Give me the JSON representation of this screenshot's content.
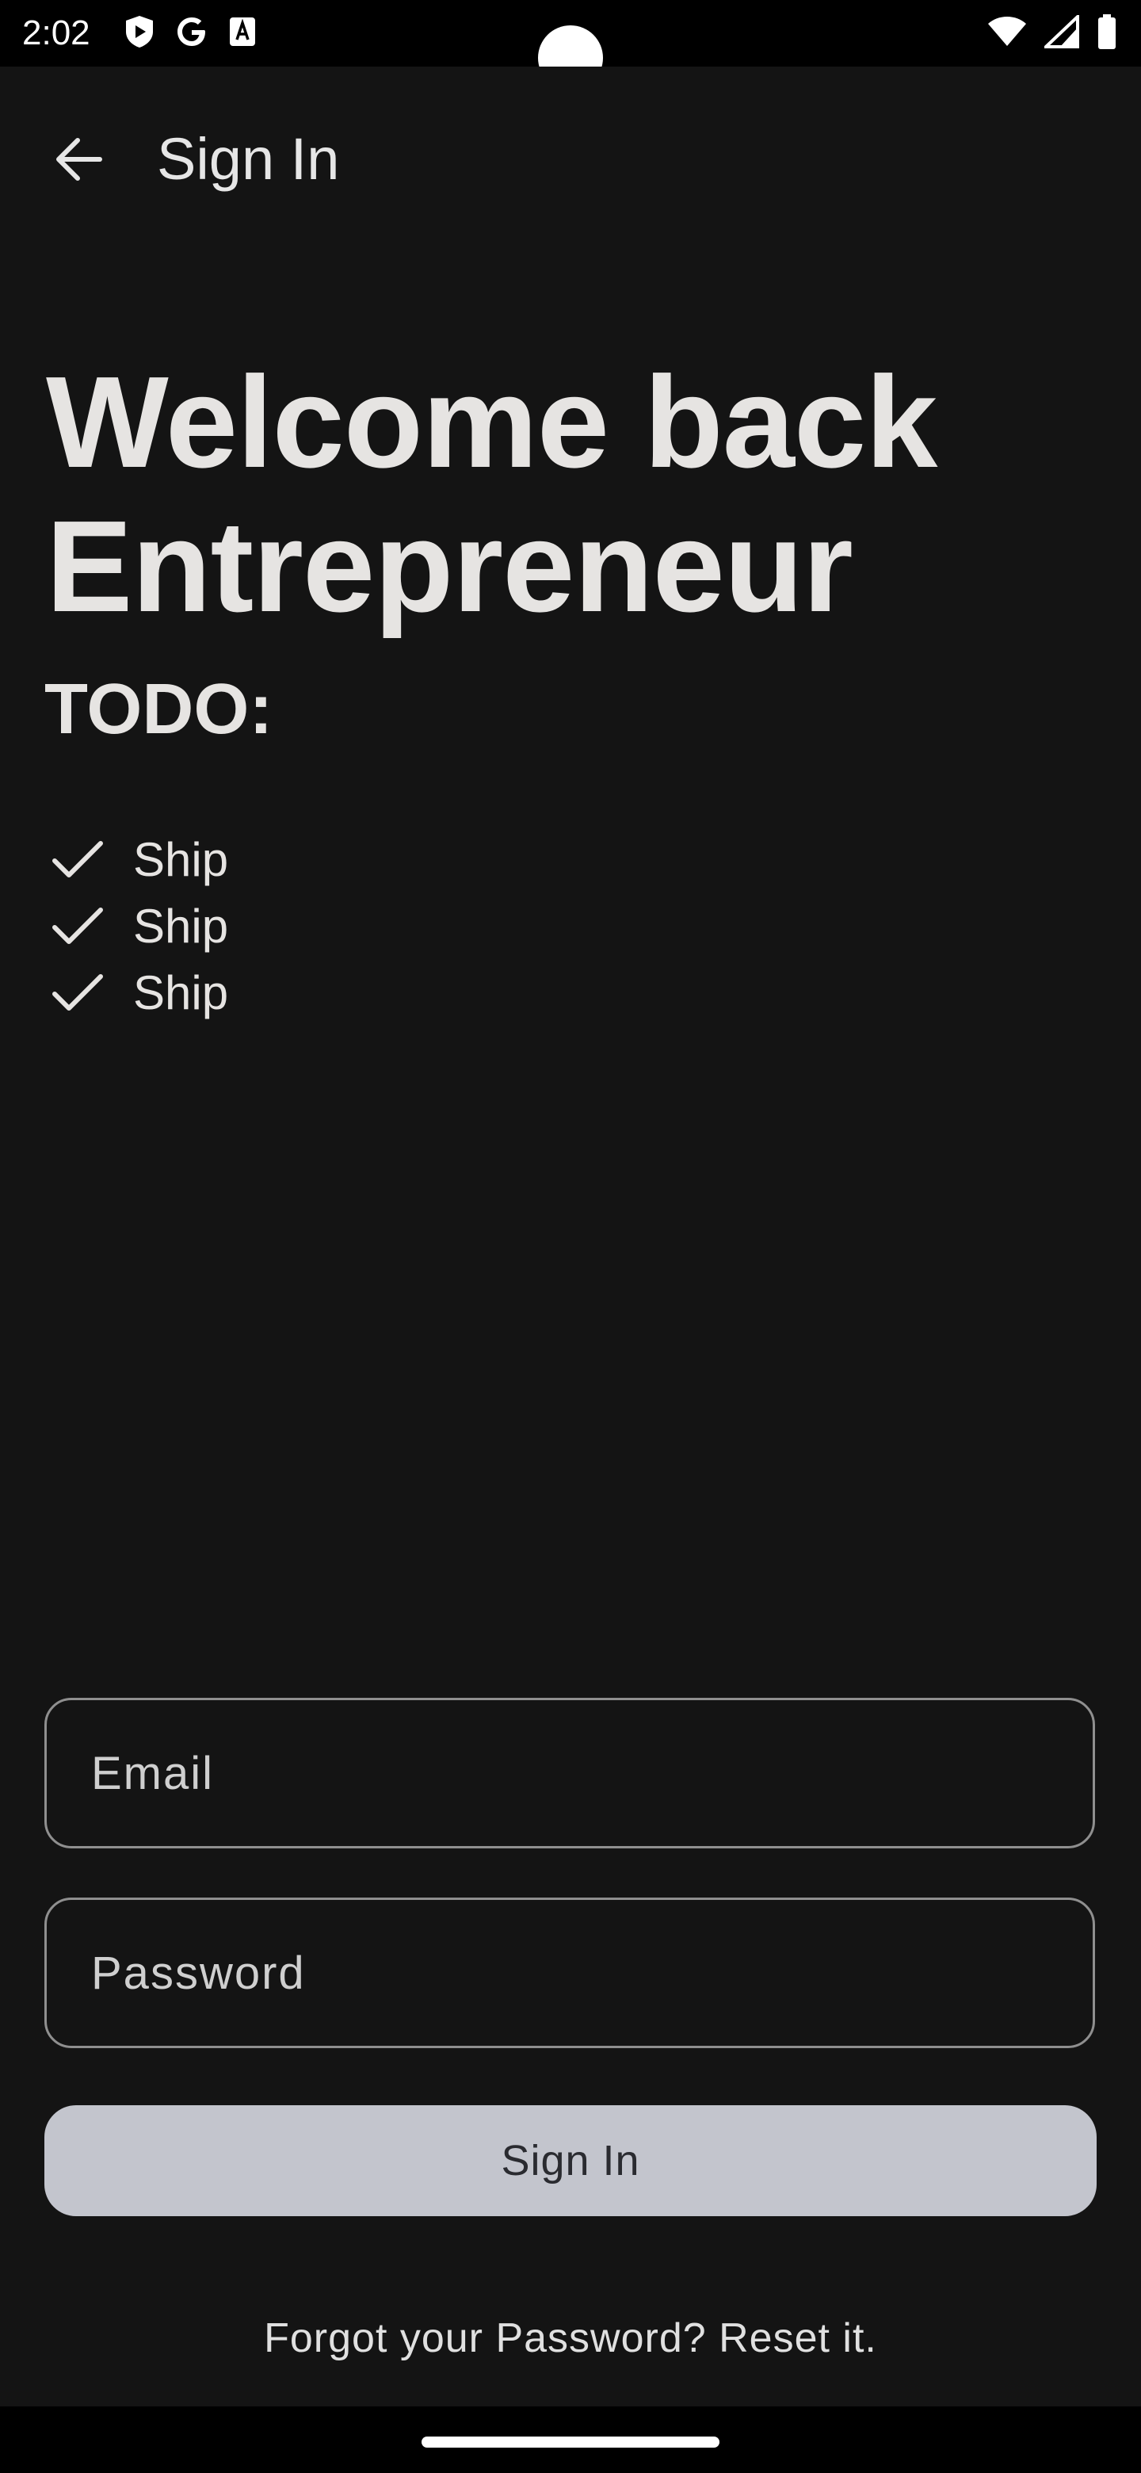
{
  "status_bar": {
    "time": "2:02",
    "left_icons": [
      "shield-play-icon",
      "google-icon",
      "keyboard-a-icon"
    ],
    "right_icons": [
      "wifi-icon",
      "cellular-signal-icon",
      "battery-icon"
    ]
  },
  "app_bar": {
    "title": "Sign In",
    "back_icon": "arrow-left-icon"
  },
  "headline": {
    "line1": "Welcome back",
    "line2": "Entrepreneur"
  },
  "todo": {
    "title": "TODO:",
    "items": [
      {
        "icon": "check-icon",
        "label": "Ship"
      },
      {
        "icon": "check-icon",
        "label": "Ship"
      },
      {
        "icon": "check-icon",
        "label": "Ship"
      }
    ]
  },
  "form": {
    "email_placeholder": "Email",
    "email_value": "",
    "password_placeholder": "Password",
    "password_value": "",
    "submit_label": "Sign In",
    "forgot_text": "Forgot your Password? Reset it."
  },
  "colors": {
    "background": "#141414",
    "text": "#e6e4e2",
    "field_border": "#8f8f8f",
    "button_background": "#c3c5cd",
    "button_text": "#2a2b30"
  }
}
